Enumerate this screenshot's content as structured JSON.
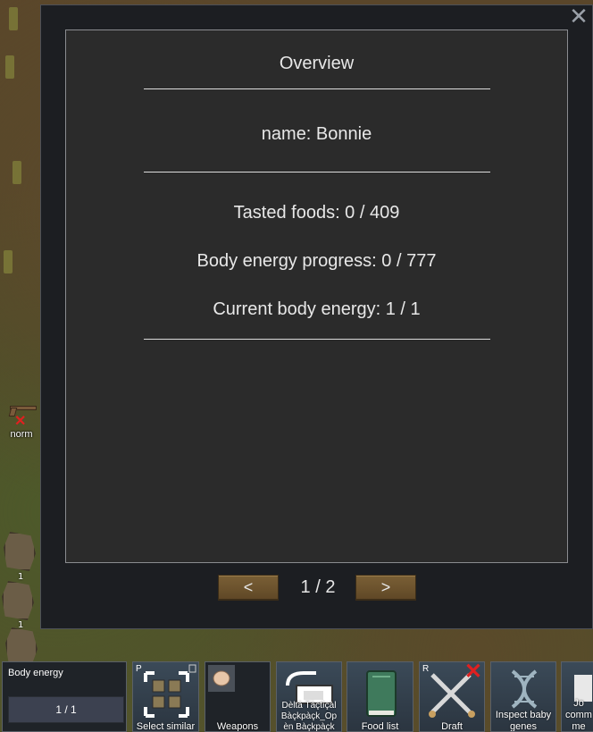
{
  "dialog": {
    "close_icon": "close-icon",
    "overview_title": "Overview",
    "name_line": "name: Bonnie",
    "stats": [
      "Tasted foods: 0 / 409",
      "Body energy progress: 0 / 777",
      "Current body energy: 1 / 1"
    ],
    "pager": {
      "prev_label": "<",
      "next_label": ">",
      "page_indicator": "1 / 2"
    }
  },
  "map": {
    "pawn_label": "norm",
    "stack_counts": [
      "1",
      "1"
    ]
  },
  "gizmos": {
    "body_energy": {
      "title": "Body energy",
      "value": "1 / 1",
      "fill_fraction": 1.0
    },
    "select_similar": {
      "label": "Select similar",
      "hotkey": "P",
      "icon": "select-similar-icon"
    },
    "weapons": {
      "label": "Weapons",
      "icon": "fist-icon"
    },
    "backpack": {
      "label": "DeltaTacticalBackpack_OpenBackpack",
      "label_visible": "Dèltà Tàçtìçàl Bàçkpàçk_Op èn Bàçkpàçk",
      "icon": "backpack-icon"
    },
    "food_list": {
      "label": "Food list",
      "icon": "book-icon"
    },
    "draft": {
      "label": "Draft",
      "hotkey": "R",
      "icon": "crossed-swords-icon",
      "disabled_mark": "red-x-icon"
    },
    "inspect_genes": {
      "label": "Inspect baby genes",
      "icon": "dna-icon"
    },
    "job_commands": {
      "label": "Jo comm me",
      "icon": "job-icon"
    }
  },
  "colors": {
    "dialog_bg": "#1c1e22",
    "panel_bg": "#2b2b2b",
    "button_brown": "#6a512c",
    "gizmo_blue": "#3b4a58",
    "red_x": "#e02020"
  }
}
